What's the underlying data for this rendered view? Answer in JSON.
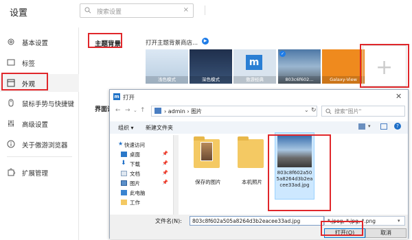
{
  "header": {
    "title": "设置",
    "search_placeholder": "搜索设置",
    "clear": "×"
  },
  "sidebar": {
    "items": [
      {
        "label": "基本设置",
        "icon": "gear-icon"
      },
      {
        "label": "标签",
        "icon": "tab-icon"
      },
      {
        "label": "外观",
        "icon": "window-icon",
        "selected": true
      },
      {
        "label": "鼠标手势与快捷键",
        "icon": "mouse-icon"
      },
      {
        "label": "高级设置",
        "icon": "sliders-icon"
      },
      {
        "label": "关于傲游浏览器",
        "icon": "info-icon"
      },
      {
        "label": "扩展管理",
        "icon": "puzzle-icon"
      }
    ]
  },
  "theme": {
    "section_title": "主题背景",
    "shop_link": "打开主题背景商店...",
    "thumbnails": [
      {
        "caption": "浅色模式",
        "color": "#c9daea"
      },
      {
        "caption": "深色模式",
        "color": "#2d3f5c"
      },
      {
        "caption": "傲游经典",
        "color": "#3a8fd8"
      },
      {
        "caption": "803c6f602...",
        "color": "#6d8fae"
      },
      {
        "caption": "Galaxy-View",
        "color": "#ef8a1e"
      }
    ]
  },
  "interface_label": "界面设",
  "dialog": {
    "title": "打开",
    "address": [
      "admin",
      "图片"
    ],
    "search_placeholder": "搜索\"图片\"",
    "organize": "组织 ▾",
    "new_folder": "新建文件夹",
    "nav_items": [
      "快速访问",
      "桌面",
      "下载",
      "文档",
      "图片",
      "此电脑",
      "工作"
    ],
    "files": [
      {
        "label": "保存的图片"
      },
      {
        "label": "本机照片"
      },
      {
        "label": "803c8f602a505a8264d3b2eacee33ad.jpg",
        "selected": true
      }
    ],
    "filename_label": "文件名(N):",
    "filename_value": "803c8f602a505a8264d3b2eacee33ad.jpg",
    "filetype_value": "*.jpeg, *.jpg, *.png",
    "open_button": "打开(O)",
    "cancel_button": "取消",
    "close": "✕"
  }
}
